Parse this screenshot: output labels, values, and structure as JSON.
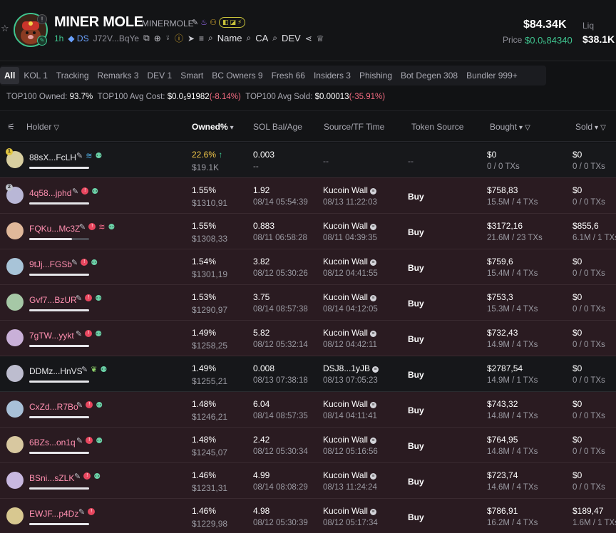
{
  "token": {
    "name": "MINER MOLE",
    "symbol": "MINERMOLE",
    "age": "1h",
    "ds_label": "DS",
    "ca_short": "J72V...BqYe",
    "search_name": "Name",
    "search_ca": "CA",
    "search_dev": "DEV",
    "market_cap": "$84.34K",
    "price_label": "Price",
    "price_value": "$0.0₅84340",
    "liq_label": "Liq",
    "liq_value": "$38.1K"
  },
  "tabs": [
    {
      "label": "All",
      "active": true
    },
    {
      "label": "KOL 1"
    },
    {
      "label": "Tracking"
    },
    {
      "label": "Remarks 3"
    },
    {
      "label": "DEV 1"
    },
    {
      "label": "Smart"
    },
    {
      "label": "BC Owners 9"
    },
    {
      "label": "Fresh 66"
    },
    {
      "label": "Insiders 3"
    },
    {
      "label": "Phishing"
    },
    {
      "label": "Bot Degen 308"
    },
    {
      "label": "Bundler 999+"
    }
  ],
  "summary": {
    "owned_label": "TOP100 Owned:",
    "owned_value": "93.7%",
    "avg_cost_label": "TOP100 Avg Cost:",
    "avg_cost_value": "$0.0₅91982",
    "avg_cost_change": "(-8.14%)",
    "avg_sold_label": "TOP100 Avg Sold:",
    "avg_sold_value": "$0.00013",
    "avg_sold_change": "(-35.91%)"
  },
  "columns": {
    "holder": "Holder",
    "owned": "Owned%",
    "sol": "SOL Bal/Age",
    "source": "Source/TF Time",
    "token_source": "Token Source",
    "bought": "Bought",
    "sold": "Sold"
  },
  "rows": [
    {
      "addr": "88sX...FcLH",
      "owned": "22.6%",
      "owned_usd": "$19.1K",
      "sol": "0.003",
      "sol_age": "--",
      "src": "--",
      "src_time": "",
      "tsrc": "--",
      "bought": "$0",
      "bought_tx": "0 / 0 TXs",
      "sold": "$0",
      "sold_tx": "0 / 0 TXs"
    },
    {
      "addr": "4q58...jphd",
      "owned": "1.55%",
      "owned_usd": "$1310,91",
      "sol": "1.92",
      "sol_age": "08/14 05:54:39",
      "src": "Kucoin Wall",
      "src_time": "08/13 11:22:03",
      "tsrc": "Buy",
      "bought": "$758,83",
      "bought_tx": "15.5M / 4 TXs",
      "sold": "$0",
      "sold_tx": "0 / 0 TXs"
    },
    {
      "addr": "FQKu...Mc3Z",
      "owned": "1.55%",
      "owned_usd": "$1308,33",
      "sol": "0.883",
      "sol_age": "08/11 06:58:28",
      "src": "Kucoin Wall",
      "src_time": "08/11 04:39:35",
      "tsrc": "Buy",
      "bought": "$3172,16",
      "bought_tx": "21.6M / 23 TXs",
      "sold": "$855,6",
      "sold_tx": "6.1M / 1 TXs"
    },
    {
      "addr": "9tJj...FGSb",
      "owned": "1.54%",
      "owned_usd": "$1301,19",
      "sol": "3.82",
      "sol_age": "08/12 05:30:26",
      "src": "Kucoin Wall",
      "src_time": "08/12 04:41:55",
      "tsrc": "Buy",
      "bought": "$759,6",
      "bought_tx": "15.4M / 4 TXs",
      "sold": "$0",
      "sold_tx": "0 / 0 TXs"
    },
    {
      "addr": "Gvf7...BzUR",
      "owned": "1.53%",
      "owned_usd": "$1290,97",
      "sol": "3.75",
      "sol_age": "08/14 08:57:38",
      "src": "Kucoin Wall",
      "src_time": "08/14 04:12:05",
      "tsrc": "Buy",
      "bought": "$753,3",
      "bought_tx": "15.3M / 4 TXs",
      "sold": "$0",
      "sold_tx": "0 / 0 TXs"
    },
    {
      "addr": "7gTW...yykt",
      "owned": "1.49%",
      "owned_usd": "$1258,25",
      "sol": "5.82",
      "sol_age": "08/12 05:32:14",
      "src": "Kucoin Wall",
      "src_time": "08/12 04:42:11",
      "tsrc": "Buy",
      "bought": "$732,43",
      "bought_tx": "14.9M / 4 TXs",
      "sold": "$0",
      "sold_tx": "0 / 0 TXs"
    },
    {
      "addr": "DDMz...HnVS",
      "owned": "1.49%",
      "owned_usd": "$1255,21",
      "sol": "0.008",
      "sol_age": "08/13 07:38:18",
      "src": "DSJ8...1yJB",
      "src_time": "08/13 07:05:23",
      "tsrc": "Buy",
      "bought": "$2787,54",
      "bought_tx": "14.9M / 1 TXs",
      "sold": "$0",
      "sold_tx": "0 / 0 TXs"
    },
    {
      "addr": "CxZd...R7Bo",
      "owned": "1.48%",
      "owned_usd": "$1246,21",
      "sol": "6.04",
      "sol_age": "08/14 08:57:35",
      "src": "Kucoin Wall",
      "src_time": "08/14 04:11:41",
      "tsrc": "Buy",
      "bought": "$743,32",
      "bought_tx": "14.8M / 4 TXs",
      "sold": "$0",
      "sold_tx": "0 / 0 TXs"
    },
    {
      "addr": "6BZs...on1q",
      "owned": "1.48%",
      "owned_usd": "$1245,07",
      "sol": "2.42",
      "sol_age": "08/12 05:30:34",
      "src": "Kucoin Wall",
      "src_time": "08/12 05:16:56",
      "tsrc": "Buy",
      "bought": "$764,95",
      "bought_tx": "14.8M / 4 TXs",
      "sold": "$0",
      "sold_tx": "0 / 0 TXs"
    },
    {
      "addr": "BSni...sZLK",
      "owned": "1.46%",
      "owned_usd": "$1231,31",
      "sol": "4.99",
      "sol_age": "08/14 08:08:29",
      "src": "Kucoin Wall",
      "src_time": "08/13 11:24:24",
      "tsrc": "Buy",
      "bought": "$723,74",
      "bought_tx": "14.6M / 4 TXs",
      "sold": "$0",
      "sold_tx": "0 / 0 TXs"
    },
    {
      "addr": "EWJF...p4Dz",
      "owned": "1.46%",
      "owned_usd": "$1229,98",
      "sol": "4.98",
      "sol_age": "08/12 05:30:39",
      "src": "Kucoin Wall",
      "src_time": "08/12 05:17:34",
      "tsrc": "Buy",
      "bought": "$786,91",
      "bought_tx": "16.2M / 4 TXs",
      "sold": "$189,47",
      "sold_tx": "1.6M / 1 TXs"
    }
  ],
  "colors": {
    "accent_green": "#3fc48f",
    "red": "#f06a7f",
    "pink_addr": "#ff8fb0",
    "row_red_bg": "#2a1b21"
  }
}
